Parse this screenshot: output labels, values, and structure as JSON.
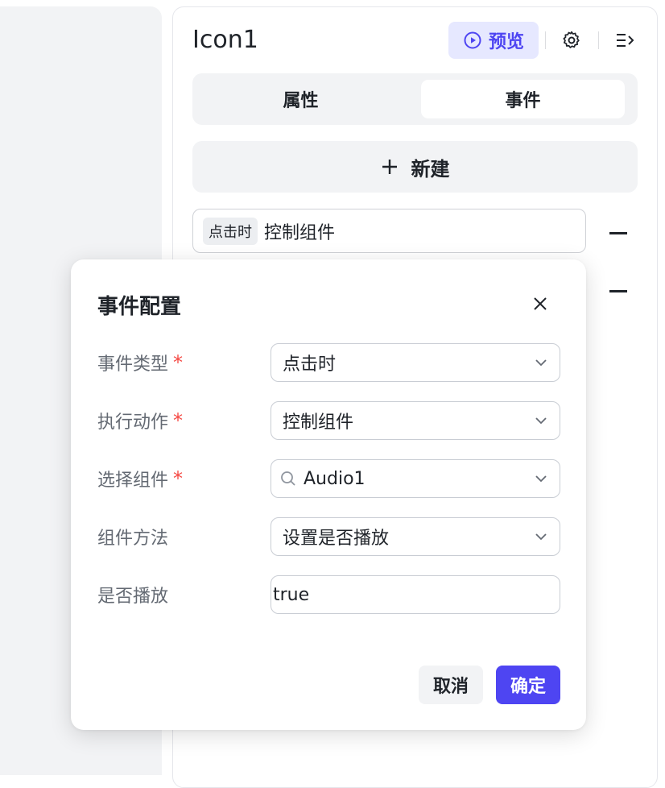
{
  "panel": {
    "title": "Icon1",
    "preview_label": "预览",
    "tabs": [
      {
        "label": "属性",
        "active": false
      },
      {
        "label": "事件",
        "active": true
      }
    ],
    "new_label": "新建",
    "event_item": {
      "tag": "点击时",
      "text": "控制组件"
    }
  },
  "modal": {
    "title": "事件配置",
    "fields": {
      "event_type": {
        "label": "事件类型",
        "required": "*",
        "value": "点击时"
      },
      "action": {
        "label": "执行动作",
        "required": "*",
        "value": "控制组件"
      },
      "component": {
        "label": "选择组件",
        "required": "*",
        "value": "Audio1"
      },
      "method": {
        "label": "组件方法",
        "value": "设置是否播放"
      },
      "play": {
        "label": "是否播放",
        "value": "true"
      }
    },
    "cancel_label": "取消",
    "ok_label": "确定"
  },
  "colors": {
    "accent": "#4e45f2",
    "accent_bg": "#e6e8ff",
    "required": "#f54a45",
    "panel_bg": "#f2f3f5"
  },
  "icons": [
    "play-circle-icon",
    "gear-icon",
    "collapse-menu-icon",
    "plus-icon",
    "minus-icon",
    "close-icon",
    "chevron-down-icon",
    "search-icon"
  ]
}
